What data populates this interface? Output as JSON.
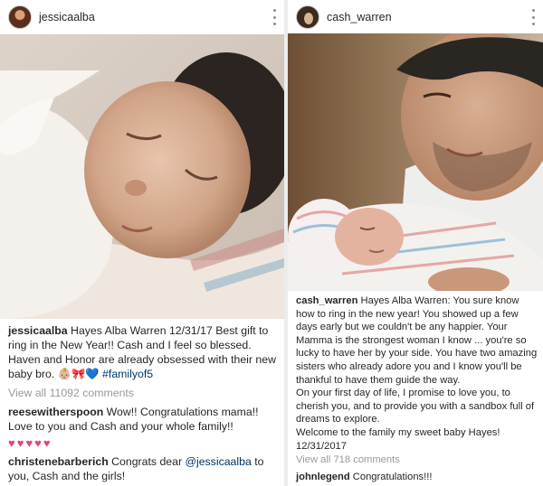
{
  "left_post": {
    "username": "jessicaalba",
    "caption_user": "jessicaalba",
    "caption_text": " Hayes Alba Warren 12/31/17 Best gift to ring in the New Year!! Cash and I feel so blessed. Haven and Honor are already obsessed with their new baby bro. ",
    "caption_emoji": "👶🏼🎀💙",
    "caption_hashtag": " #familyof5",
    "view_all": "View all 11092 comments",
    "comments": [
      {
        "user": "reesewitherspoon",
        "text": " Wow!! Congratulations mama!! Love to you and Cash and your whole family!!"
      },
      {
        "user": "christenebarberich",
        "text_before": " Congrats dear ",
        "mention": "@jessicaalba",
        "text_after": " to you, Cash and the girls!"
      }
    ],
    "hearts": "♥♥♥♥♥"
  },
  "right_post": {
    "username": "cash_warren",
    "caption_user": "cash_warren",
    "caption_text": " Hayes Alba Warren:  You sure know how to ring in the new year!  You showed up a few days early but we couldn't be any happier. Your Mamma is the strongest woman I know ... you're so lucky to have her by your side. You have two amazing sisters who already adore you and I know you'll be thankful to have them guide the way.",
    "caption_p2": "On your first day of life, I promise to love you, to cherish you, and to provide you with a sandbox full of dreams to explore.",
    "caption_p3": "Welcome to the family my sweet baby Hayes!",
    "caption_date": "12/31/2017",
    "view_all": "View all 718 comments",
    "comments": [
      {
        "user": "johnlegend",
        "text": " Congratulations!!!"
      }
    ]
  },
  "colors": {
    "text": "#262626",
    "muted": "#999999",
    "link": "#003569",
    "hearts": "#e0457b"
  },
  "icons": [
    "more-vertical-icon",
    "avatar"
  ]
}
